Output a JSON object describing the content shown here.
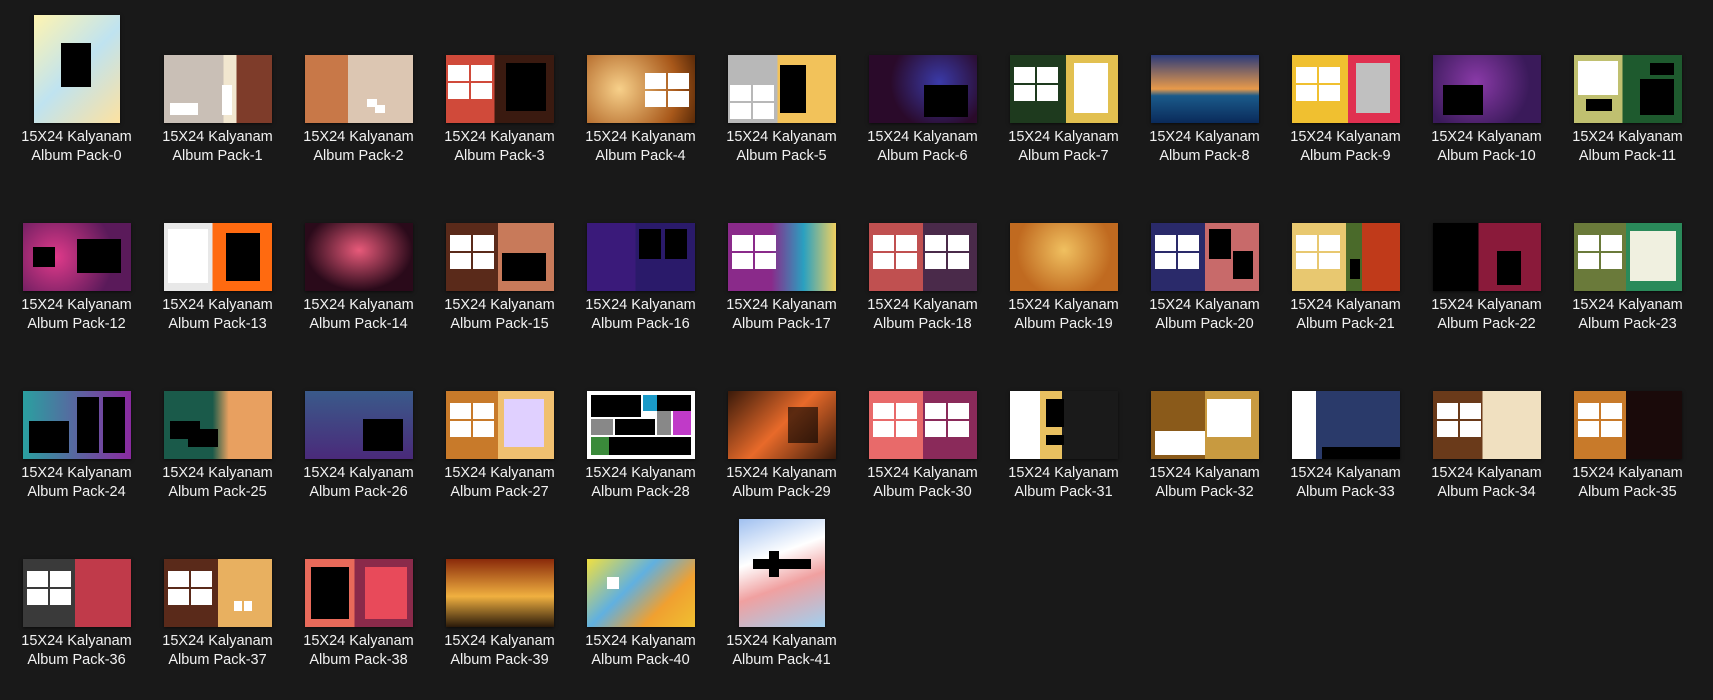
{
  "items": [
    {
      "line1": "15X24 Kalyanam",
      "line2": "Album Pack-0"
    },
    {
      "line1": "15X24 Kalyanam",
      "line2": "Album Pack-1"
    },
    {
      "line1": "15X24 Kalyanam",
      "line2": "Album Pack-2"
    },
    {
      "line1": "15X24 Kalyanam",
      "line2": "Album Pack-3"
    },
    {
      "line1": "15X24 Kalyanam",
      "line2": "Album Pack-4"
    },
    {
      "line1": "15X24 Kalyanam",
      "line2": "Album Pack-5"
    },
    {
      "line1": "15X24 Kalyanam",
      "line2": "Album Pack-6"
    },
    {
      "line1": "15X24 Kalyanam",
      "line2": "Album Pack-7"
    },
    {
      "line1": "15X24 Kalyanam",
      "line2": "Album Pack-8"
    },
    {
      "line1": "15X24 Kalyanam",
      "line2": "Album Pack-9"
    },
    {
      "line1": "15X24 Kalyanam",
      "line2": "Album Pack-10"
    },
    {
      "line1": "15X24 Kalyanam",
      "line2": "Album Pack-11"
    },
    {
      "line1": "15X24 Kalyanam",
      "line2": "Album Pack-12"
    },
    {
      "line1": "15X24 Kalyanam",
      "line2": "Album Pack-13"
    },
    {
      "line1": "15X24 Kalyanam",
      "line2": "Album Pack-14"
    },
    {
      "line1": "15X24 Kalyanam",
      "line2": "Album Pack-15"
    },
    {
      "line1": "15X24 Kalyanam",
      "line2": "Album Pack-16"
    },
    {
      "line1": "15X24 Kalyanam",
      "line2": "Album Pack-17"
    },
    {
      "line1": "15X24 Kalyanam",
      "line2": "Album Pack-18"
    },
    {
      "line1": "15X24 Kalyanam",
      "line2": "Album Pack-19"
    },
    {
      "line1": "15X24 Kalyanam",
      "line2": "Album Pack-20"
    },
    {
      "line1": "15X24 Kalyanam",
      "line2": "Album Pack-21"
    },
    {
      "line1": "15X24 Kalyanam",
      "line2": "Album Pack-22"
    },
    {
      "line1": "15X24 Kalyanam",
      "line2": "Album Pack-23"
    },
    {
      "line1": "15X24 Kalyanam",
      "line2": "Album Pack-24"
    },
    {
      "line1": "15X24 Kalyanam",
      "line2": "Album Pack-25"
    },
    {
      "line1": "15X24 Kalyanam",
      "line2": "Album Pack-26"
    },
    {
      "line1": "15X24 Kalyanam",
      "line2": "Album Pack-27"
    },
    {
      "line1": "15X24 Kalyanam",
      "line2": "Album Pack-28"
    },
    {
      "line1": "15X24 Kalyanam",
      "line2": "Album Pack-29"
    },
    {
      "line1": "15X24 Kalyanam",
      "line2": "Album Pack-30"
    },
    {
      "line1": "15X24 Kalyanam",
      "line2": "Album Pack-31"
    },
    {
      "line1": "15X24 Kalyanam",
      "line2": "Album Pack-32"
    },
    {
      "line1": "15X24 Kalyanam",
      "line2": "Album Pack-33"
    },
    {
      "line1": "15X24 Kalyanam",
      "line2": "Album Pack-34"
    },
    {
      "line1": "15X24 Kalyanam",
      "line2": "Album Pack-35"
    },
    {
      "line1": "15X24 Kalyanam",
      "line2": "Album Pack-36"
    },
    {
      "line1": "15X24 Kalyanam",
      "line2": "Album Pack-37"
    },
    {
      "line1": "15X24 Kalyanam",
      "line2": "Album Pack-38"
    },
    {
      "line1": "15X24 Kalyanam",
      "line2": "Album Pack-39"
    },
    {
      "line1": "15X24 Kalyanam",
      "line2": "Album Pack-40"
    },
    {
      "line1": "15X24 Kalyanam",
      "line2": "Album Pack-41"
    }
  ],
  "colors": {
    "background": "#191919",
    "caption_text": "#f2f2f2"
  }
}
